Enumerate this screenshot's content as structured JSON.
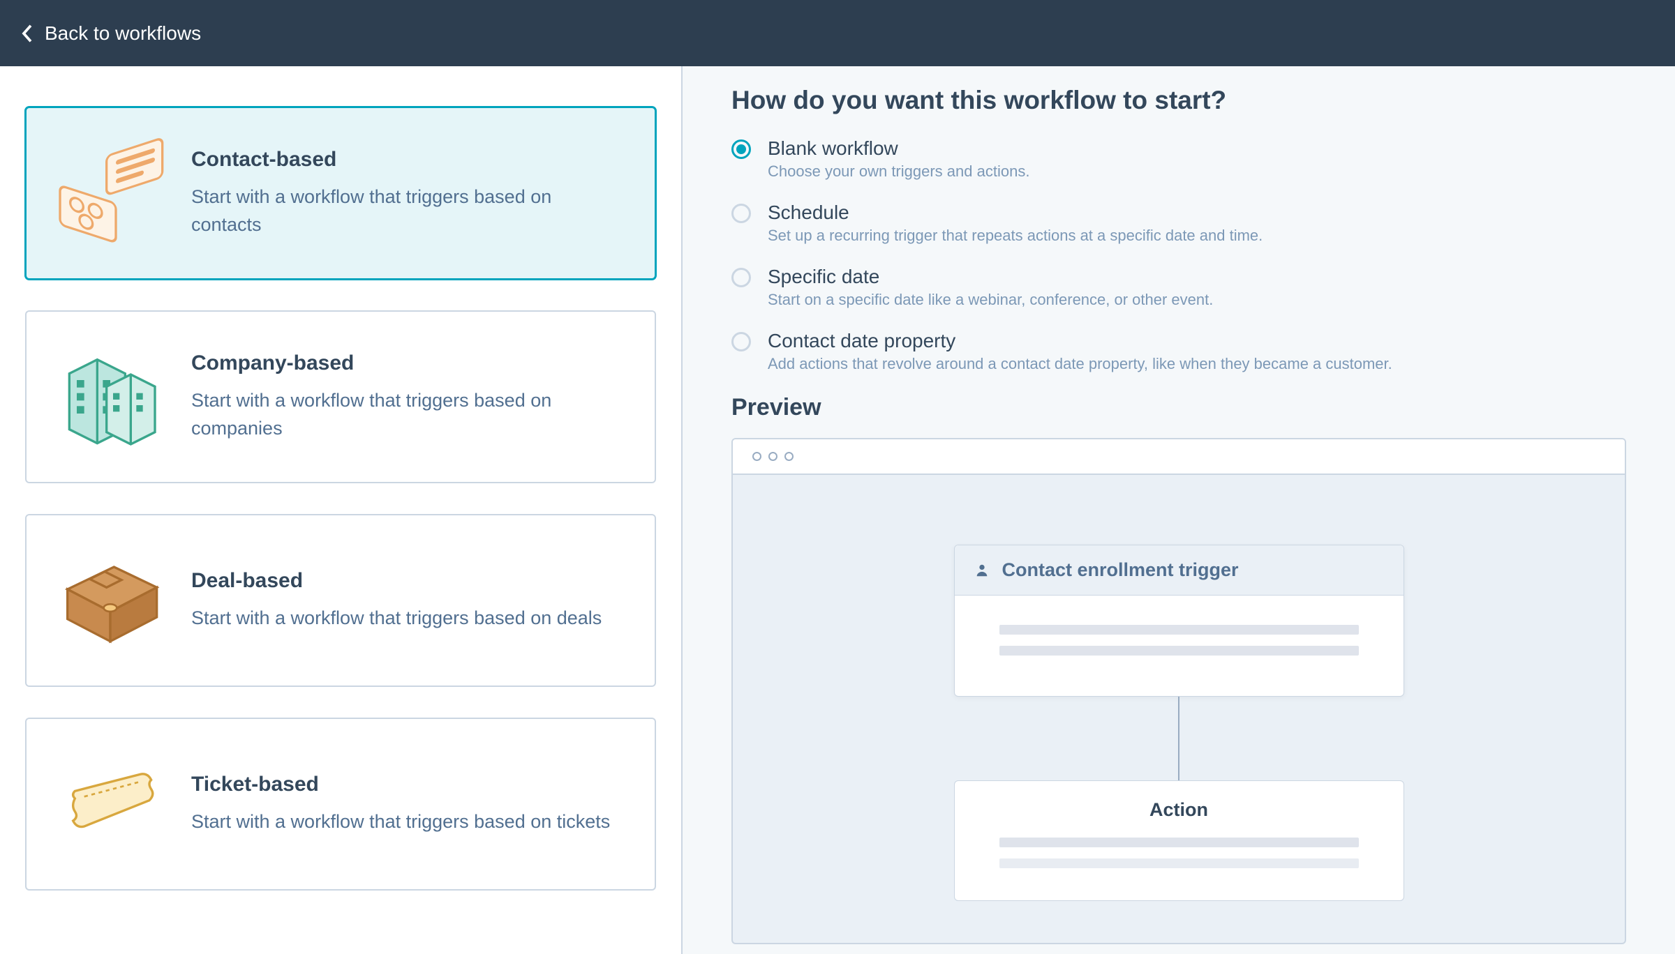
{
  "header": {
    "back_label": "Back to workflows"
  },
  "basis_cards": [
    {
      "id": "contact",
      "title": "Contact-based",
      "description": "Start with a workflow that triggers based on contacts",
      "selected": true
    },
    {
      "id": "company",
      "title": "Company-based",
      "description": "Start with a workflow that triggers based on companies",
      "selected": false
    },
    {
      "id": "deal",
      "title": "Deal-based",
      "description": "Start with a workflow that triggers based on deals",
      "selected": false
    },
    {
      "id": "ticket",
      "title": "Ticket-based",
      "description": "Start with a workflow that triggers based on tickets",
      "selected": false
    }
  ],
  "right": {
    "title": "How do you want this workflow to start?",
    "options": [
      {
        "id": "blank",
        "label": "Blank workflow",
        "description": "Choose your own triggers and actions.",
        "checked": true
      },
      {
        "id": "schedule",
        "label": "Schedule",
        "description": "Set up a recurring trigger that repeats actions at a specific date and time.",
        "checked": false
      },
      {
        "id": "specific-date",
        "label": "Specific date",
        "description": "Start on a specific date like a webinar, conference, or other event.",
        "checked": false
      },
      {
        "id": "contact-date",
        "label": "Contact date property",
        "description": "Add actions that revolve around a contact date property, like when they became a customer.",
        "checked": false
      }
    ],
    "preview_title": "Preview",
    "trigger_card_title": "Contact enrollment trigger",
    "action_card_title": "Action"
  }
}
